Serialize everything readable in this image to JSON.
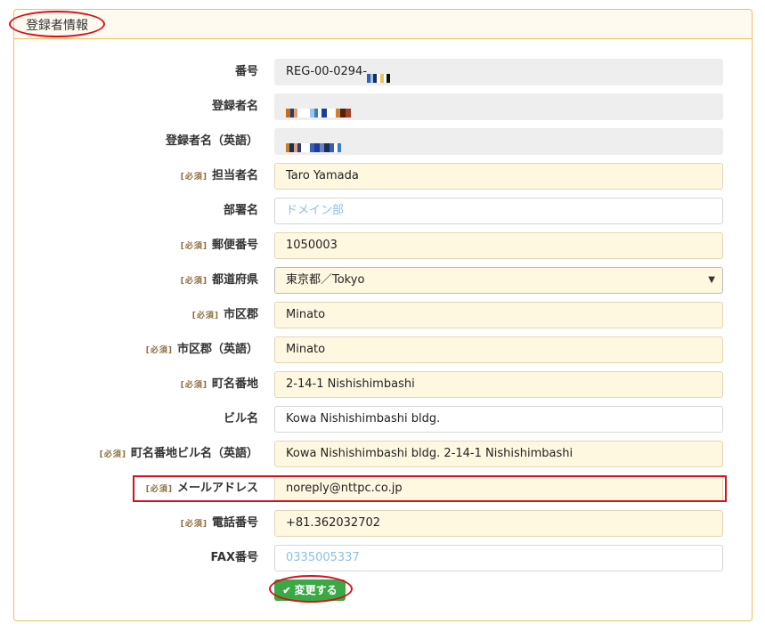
{
  "panel": {
    "title": "登録者情報"
  },
  "required_tag": "[必須]",
  "fields": {
    "number": {
      "label": "番号",
      "value": "REG-00-0294-"
    },
    "registrant_name": {
      "label": "登録者名"
    },
    "registrant_name_en": {
      "label": "登録者名（英語）"
    },
    "contact_name": {
      "label": "担当者名",
      "value": "Taro Yamada"
    },
    "department": {
      "label": "部署名",
      "placeholder": "ドメイン部"
    },
    "postal_code": {
      "label": "郵便番号",
      "value": "1050003"
    },
    "prefecture": {
      "label": "都道府県",
      "value": "東京都／Tokyo"
    },
    "city": {
      "label": "市区郡",
      "value": "Minato"
    },
    "city_en": {
      "label": "市区郡（英語）",
      "value": "Minato"
    },
    "street": {
      "label": "町名番地",
      "value": "2-14-1 Nishishimbashi"
    },
    "building": {
      "label": "ビル名",
      "value": "Kowa Nishishimbashi bldg."
    },
    "street_building_en": {
      "label": "町名番地ビル名（英語）",
      "value": "Kowa Nishishimbashi bldg. 2-14-1 Nishishimbashi"
    },
    "email": {
      "label": "メールアドレス",
      "value": "noreply@nttpc.co.jp"
    },
    "phone": {
      "label": "電話番号",
      "value": "+81.362032702"
    },
    "fax": {
      "label": "FAX番号",
      "placeholder": "0335005337"
    }
  },
  "submit": {
    "label": "変更する",
    "icon": "check-icon",
    "color": "#3aa845"
  },
  "colors": {
    "annotation": "#d9101c",
    "panel_border": "#f0c060",
    "required_bg": "#fff8e1",
    "placeholder": "#8cc0e8"
  }
}
